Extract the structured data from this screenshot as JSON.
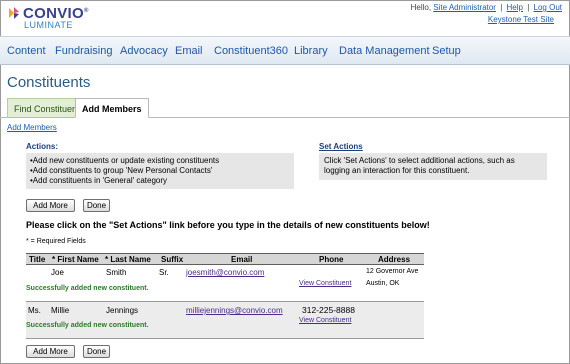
{
  "brand": {
    "name": "CONVIO",
    "tm": "®",
    "sub": "LUMINATE"
  },
  "top_links": {
    "greeting": "Hello,",
    "user": "Site Administrator",
    "help": "Help",
    "logout": "Log Out",
    "sep": "|",
    "org": "Keystone Test Site"
  },
  "nav": [
    "Content",
    "Fundraising",
    "Advocacy",
    "Email",
    "Constituent360",
    "Library",
    "Data Management",
    "Setup"
  ],
  "page_title": "Constituents",
  "tabs": [
    {
      "label": "Find Constituent"
    },
    {
      "label": "Add Members"
    }
  ],
  "sub_link": "Add Members",
  "actions": {
    "title": "Actions:",
    "items": [
      "•Add new constituents or update existing constituents",
      "•Add constituents to group 'New Personal Contacts'",
      "•Add constituents in 'General' category"
    ]
  },
  "set_actions": {
    "title": "Set Actions",
    "text": "Click 'Set Actions' to select additional actions, such as logging an interaction for this constituent."
  },
  "buttons": {
    "add_more": "Add More",
    "done": "Done"
  },
  "warning": "Please click on the \"Set Actions\" link before you type in the details of new constituents below!",
  "required_note": "* = Required Fields",
  "table": {
    "headers": [
      "Title",
      "* First Name",
      "* Last Name",
      "Suffix",
      "Email",
      "Phone",
      "Address"
    ],
    "rows": [
      {
        "title": "",
        "first": "Joe",
        "last": "Smith",
        "suffix": "Sr.",
        "email": "joesmith@convio.com",
        "phone": "",
        "view": "View Constituent",
        "address1": "12 Governor Ave",
        "address2": "Austin, OK",
        "status": "Successfully added new constituent."
      },
      {
        "title": "Ms.",
        "first": "Millie",
        "last": "Jennings",
        "suffix": "",
        "email": "milliejennings@convio.com",
        "phone": "312-225-8888",
        "view": "View Constituent",
        "address1": "",
        "address2": "",
        "status": "Successfully added new constituent."
      }
    ]
  }
}
